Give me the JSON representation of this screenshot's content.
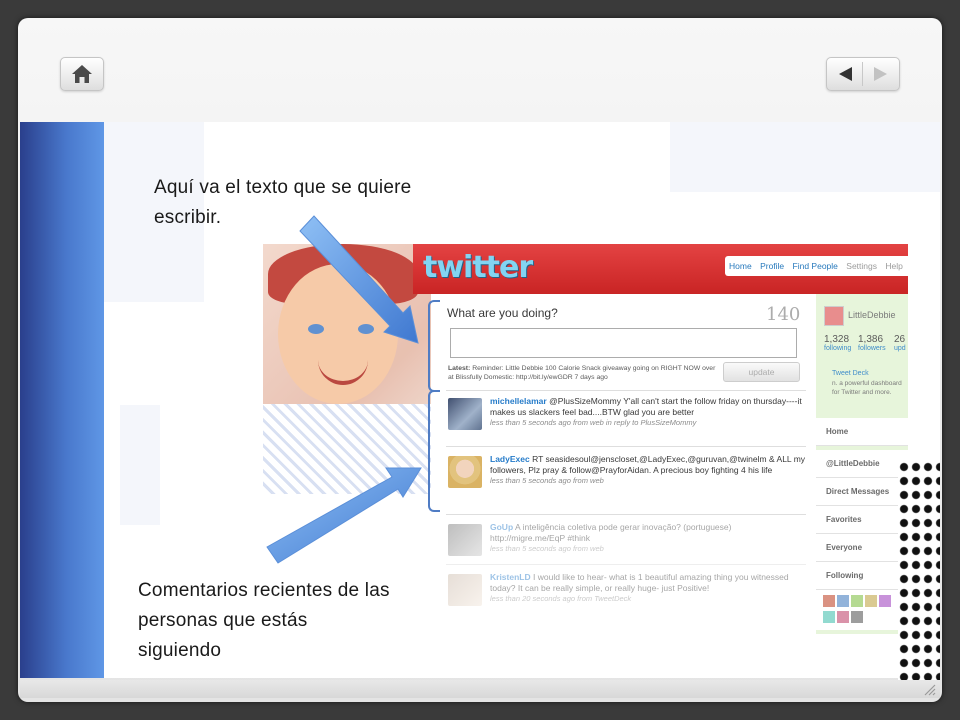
{
  "toolbar": {
    "home_icon": "home-icon",
    "prev_icon": "prev-arrow-icon",
    "next_icon": "next-arrow-icon"
  },
  "callouts": {
    "top_line1": "Aquí va el texto que se quiere",
    "top_line2": "escribir.",
    "bottom_line1": "Comentarios recientes de las",
    "bottom_line2": "personas que estás",
    "bottom_line3": "siguiendo"
  },
  "twitter": {
    "logo": "twitter",
    "nav": [
      "Home",
      "Profile",
      "Find People",
      "Settings",
      "Help"
    ],
    "prompt": "What are you doing?",
    "char_count": "140",
    "latest_label": "Latest:",
    "latest_text": "Reminder: Little Debbie 100 Calorie Snack giveaway going on RIGHT NOW over at Blissfully Domestic: http://bit.ly/ewGDR 7 days ago",
    "update_label": "update",
    "tweets": [
      {
        "user": "michellelamar",
        "text": "@PlusSizeMommy Y'all can't start the follow friday on thursday----it makes us slackers feel bad....BTW glad you are better",
        "meta": "less than 5 seconds ago from web in reply to PlusSizeMommy"
      },
      {
        "user": "LadyExec",
        "text": "RT seasidesoul@jenscloset,@LadyExec,@guruvan,@twinelm & ALL my followers, Plz pray & follow@PrayforAidan. A precious boy fighting 4 his life",
        "meta": "less than 5 seconds ago from web"
      },
      {
        "user": "GoUp",
        "text": "A inteligência coletiva pode gerar inovação? (portuguese) http://migre.me/EqP #think",
        "meta": "less than 5 seconds ago from web"
      },
      {
        "user": "KristenLD",
        "text": "I would like to hear- what is 1 beautiful amazing thing you witnessed today? It can be really simple, or really huge- just Positive!",
        "meta": "less than 20 seconds ago from TweetDeck"
      }
    ],
    "sidebar": {
      "profile_name": "LittleDebbie",
      "following_count": "1,328",
      "following_label": "following",
      "followers_count": "1,386",
      "followers_label": "followers",
      "updates_count": "26",
      "updates_label": "upd",
      "ad_title": "Tweet Deck",
      "ad_text": "n. a powerful dashboard for Twitter and more.",
      "nav": [
        "Home",
        "@LittleDebbie",
        "Direct Messages",
        "Favorites",
        "Everyone",
        "Following"
      ]
    }
  },
  "colors": {
    "twitter_red": "#c81e1e",
    "arrow_blue": "#4f86d8",
    "left_bar": "#3a5cae"
  }
}
